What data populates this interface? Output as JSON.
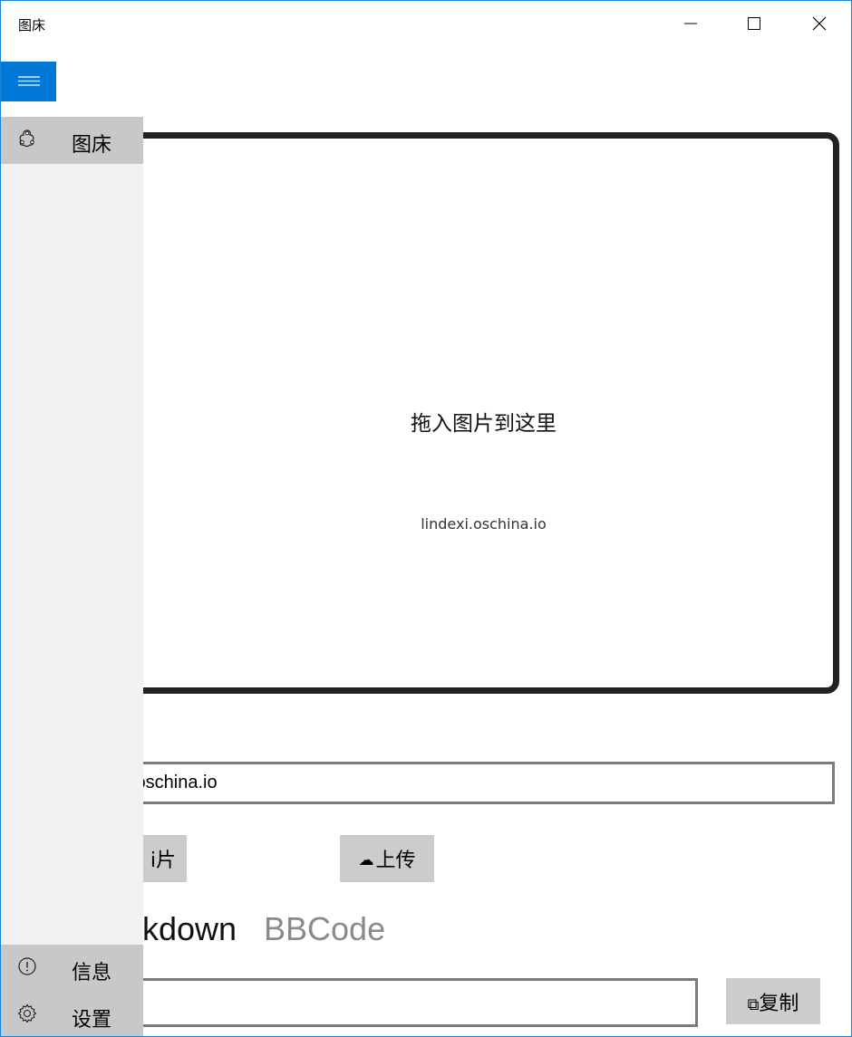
{
  "window": {
    "title": "图床"
  },
  "titlebar": {
    "minimize_icon": "minimize-icon",
    "maximize_icon": "maximize-icon",
    "close_icon": "close-icon"
  },
  "nav": {
    "menu_icon": "hamburger-icon",
    "items": [
      {
        "icon": "cloud-network-icon",
        "label": "图床"
      }
    ],
    "footer": [
      {
        "icon": "info-icon",
        "label": "信息"
      },
      {
        "icon": "gear-icon",
        "label": "设置"
      }
    ],
    "accent": "#0078d7"
  },
  "dropzone": {
    "prompt": "拖入图片到这里",
    "subtitle": "lindexi.oschina.io"
  },
  "url_field": {
    "value": "ti.oschina.io"
  },
  "buttons": {
    "select_image": "i片",
    "upload": "上传",
    "upload_icon": "cloud-upload-icon",
    "copy": "复制",
    "copy_icon": "copy-icon"
  },
  "tabs": [
    {
      "label": "kdown",
      "selected": true
    },
    {
      "label": "BBCode",
      "selected": false
    }
  ],
  "code_field": {
    "value": ""
  }
}
